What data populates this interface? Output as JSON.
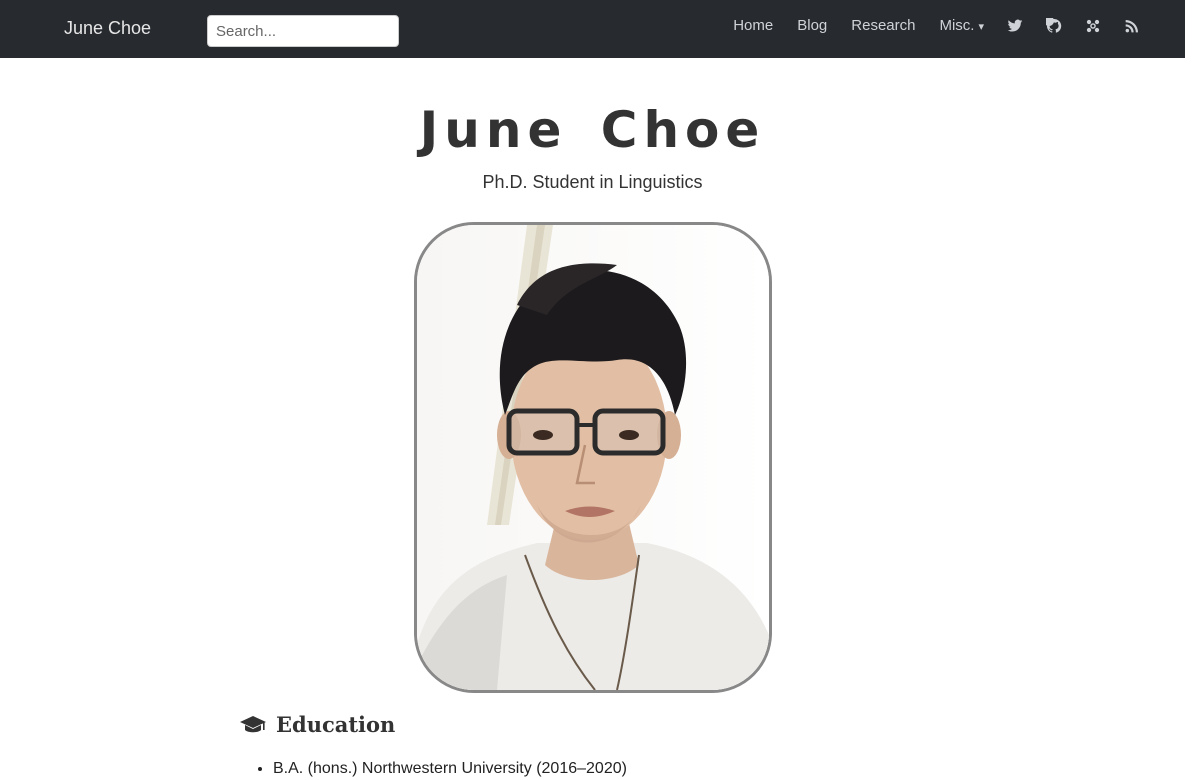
{
  "header": {
    "site_title": "June Choe",
    "search": {
      "placeholder": "Search...",
      "value": ""
    },
    "nav": [
      {
        "label": "Home"
      },
      {
        "label": "Blog"
      },
      {
        "label": "Research"
      },
      {
        "label": "Misc.",
        "caret": "▾"
      }
    ],
    "icons": [
      "twitter-icon",
      "github-icon",
      "osf-icon",
      "rss-icon"
    ]
  },
  "profile": {
    "name": "June Choe",
    "subtitle": "Ph.D. Student in Linguistics"
  },
  "education": {
    "heading": "Education",
    "items": [
      "B.A. (hons.) Northwestern University (2016–2020)"
    ]
  },
  "colors": {
    "navbar_bg": "#272b30",
    "nav_text": "#cfd2d6",
    "body_text": "#333333",
    "photo_border": "#888888"
  }
}
